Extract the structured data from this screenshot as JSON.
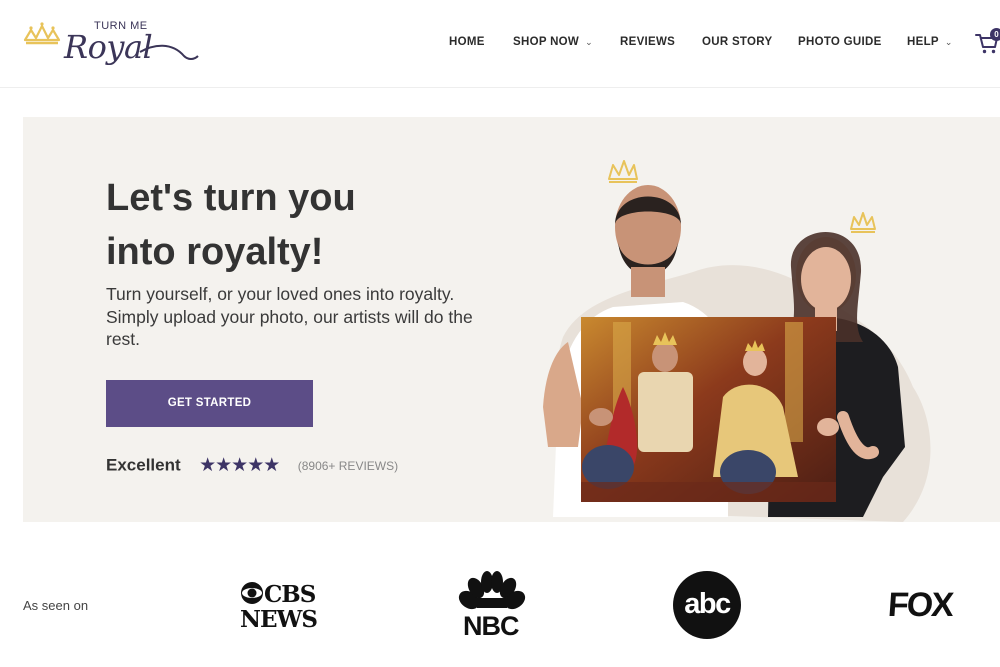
{
  "brand": {
    "name_small": "TURN ME",
    "name_script": "Royal",
    "accent_color": "#5c4d87",
    "gold_color": "#e8c35a"
  },
  "nav": {
    "items": [
      {
        "label": "HOME",
        "has_dropdown": false
      },
      {
        "label": "SHOP NOW",
        "has_dropdown": true
      },
      {
        "label": "REVIEWS",
        "has_dropdown": false
      },
      {
        "label": "OUR STORY",
        "has_dropdown": false
      },
      {
        "label": "PHOTO GUIDE",
        "has_dropdown": false
      },
      {
        "label": "HELP",
        "has_dropdown": true
      }
    ],
    "dropdown_icon": "chevron-down-icon",
    "cart_icon": "cart-icon",
    "cart_count": "0"
  },
  "hero": {
    "title_line1": "Let's turn you",
    "title_line2": "into royalty!",
    "subtitle": "Turn yourself, or your loved ones into royalty. Simply upload your photo, our artists will do the rest.",
    "cta_label": "GET STARTED",
    "rating_label": "Excellent",
    "stars": "★★★★★",
    "star_count": 5,
    "reviews_count": "(8906+ REVIEWS)",
    "image_description_icon": "couple-holding-royal-portrait-image"
  },
  "press": {
    "label": "As seen on",
    "logos": [
      {
        "name": "cbs-news-logo",
        "line1": "CBS",
        "line2": "NEWS"
      },
      {
        "name": "nbc-logo",
        "text": "NBC"
      },
      {
        "name": "abc-logo",
        "text": "abc"
      },
      {
        "name": "fox-logo",
        "text": "FOX"
      }
    ]
  }
}
